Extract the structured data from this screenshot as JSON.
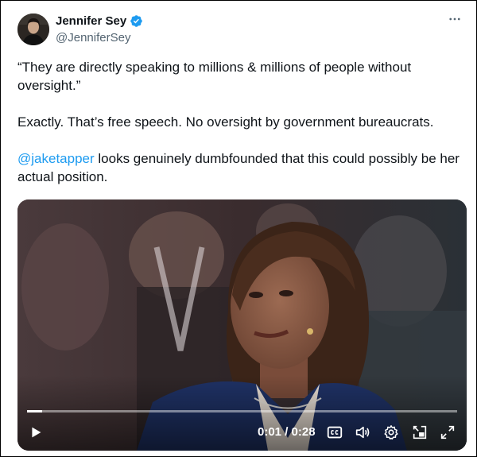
{
  "author": {
    "display_name": "Jennifer Sey",
    "handle": "@JenniferSey",
    "verified": true
  },
  "tweet": {
    "paragraph1": "“They are directly speaking to millions & millions of people without oversight.”",
    "paragraph2": "Exactly. That’s free speech. No oversight by government bureaucrats.",
    "mention": "@jaketapper",
    "paragraph3_rest": " looks genuinely dumbfounded that this could possibly be her actual position."
  },
  "video": {
    "time_display": "0:01 / 0:28",
    "progress": 0.036
  },
  "icons": {
    "more": "more-dots-icon",
    "verified": "verified-badge-icon",
    "play": "play-icon",
    "captions": "captions-icon",
    "volume": "volume-icon",
    "settings": "settings-gear-icon",
    "pip": "picture-in-picture-icon",
    "fullscreen": "fullscreen-icon"
  },
  "colors": {
    "link": "#1d9bf0",
    "verified": "#1d9bf0",
    "secondary_text": "#536471"
  }
}
